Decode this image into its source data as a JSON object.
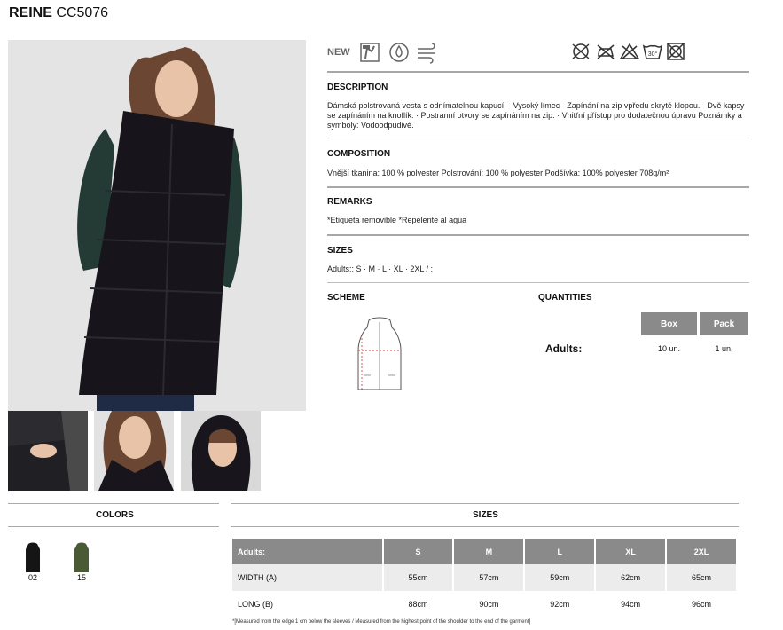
{
  "title": {
    "name": "REINE",
    "code": "CC5076"
  },
  "badge_new": "NEW",
  "description": {
    "heading": "DESCRIPTION",
    "text": "Dámská polstrovaná vesta s odnímatelnou kapucí. · Vysoký límec · Zapínání na zip vpředu skryté klopou. · Dvě kapsy se zapínáním na knoflík. · Postranní otvory se zapínáním na zip. · Vnitřní přístup pro dodatečnou úpravu Poznámky a symboly: Vodoodpudivé."
  },
  "composition": {
    "heading": "COMPOSITION",
    "text": "Vnější tkanina: 100 % polyester Polstrování: 100 % polyester Podšívka: 100% polyester 708g/m²"
  },
  "remarks": {
    "heading": "REMARKS",
    "text": "*Etiqueta removible *Repelente al agua"
  },
  "sizes_info": {
    "heading": "SIZES",
    "text": "Adults:: S · M · L · XL · 2XL / :"
  },
  "scheme": {
    "heading": "SCHEME"
  },
  "quantities": {
    "heading": "QUANTITIES",
    "label": "Adults:",
    "box_label": "Box",
    "pack_label": "Pack",
    "box_value": "10 un.",
    "pack_value": "1 un."
  },
  "care": {
    "temperature": "30°"
  },
  "colors": {
    "heading": "COLORS",
    "items": [
      {
        "code": "02",
        "color": "#151515"
      },
      {
        "code": "15",
        "color": "#4a5a34"
      }
    ]
  },
  "size_table": {
    "heading": "SIZES",
    "columns": [
      "Adults:",
      "S",
      "M",
      "L",
      "XL",
      "2XL"
    ],
    "rows": [
      {
        "label": "WIDTH (A)",
        "values": [
          "55cm",
          "57cm",
          "59cm",
          "62cm",
          "65cm"
        ]
      },
      {
        "label": "LONG (B)",
        "values": [
          "88cm",
          "90cm",
          "92cm",
          "94cm",
          "96cm"
        ]
      }
    ],
    "footnote": "*[Measured from the edge 1 cm below the sleeves / Measured from the highest point of the shoulder to the end of the garment]"
  }
}
